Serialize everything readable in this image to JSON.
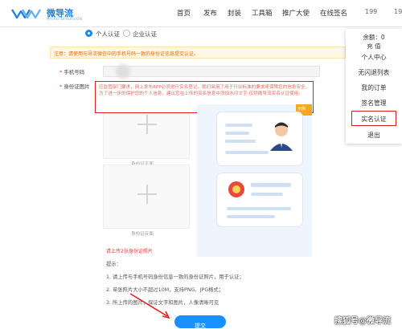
{
  "brand": {
    "name": "微导流",
    "subtitle": "MICRO DIVERSION"
  },
  "nav": {
    "items": [
      "首页",
      "发布",
      "封装",
      "工具箱",
      "推广大使",
      "在线签名"
    ],
    "phone_partial": "199",
    "phone_tail": "19"
  },
  "tabs": [
    {
      "label": "个人认证",
      "selected": true
    },
    {
      "label": "企业认证",
      "selected": false
    }
  ],
  "notice": "注意：请使用与导流微信中的手机号码一致的身份证信息提交认证。",
  "form": {
    "phone_label": "手机号码",
    "id_label": "身份证图片",
    "warning_text": "应监管部门要求，网上发布APP必须进行实名登记，我们采用了用于行业标准的要求来保障您的信息安全，为了进一步的保护您的个人信息，建议您在上传的实名信息中添加水印文字-仅供微导流实名认证使用。",
    "front_caption": "身份证正面",
    "back_caption": "身份证反面",
    "sample_badge": "示例"
  },
  "tips": {
    "alert": "请上传2张身份证照片",
    "heading": "提示：",
    "items": [
      "1. 请上传与手机号码身份信息一致的身份证照片，用于认证；",
      "2. 单张照片大小不超过10M，支持PNG、JPG格式；",
      "3. 所上传的图片，保证文字和图片，人像清晰可见"
    ]
  },
  "submit_label": "提交",
  "watermark": "搜狐号@微导流",
  "dropdown": {
    "balance_label": "余额：0",
    "recharge_label": "充 值",
    "items": [
      "个人中心",
      "无闪退列表",
      "我的订单",
      "签名管理",
      "实名认证",
      "退出"
    ],
    "highlighted": "实名认证"
  },
  "colors": {
    "accent": "#1890ff",
    "warning": "#e53935",
    "notice_bg": "#fff7e6"
  }
}
